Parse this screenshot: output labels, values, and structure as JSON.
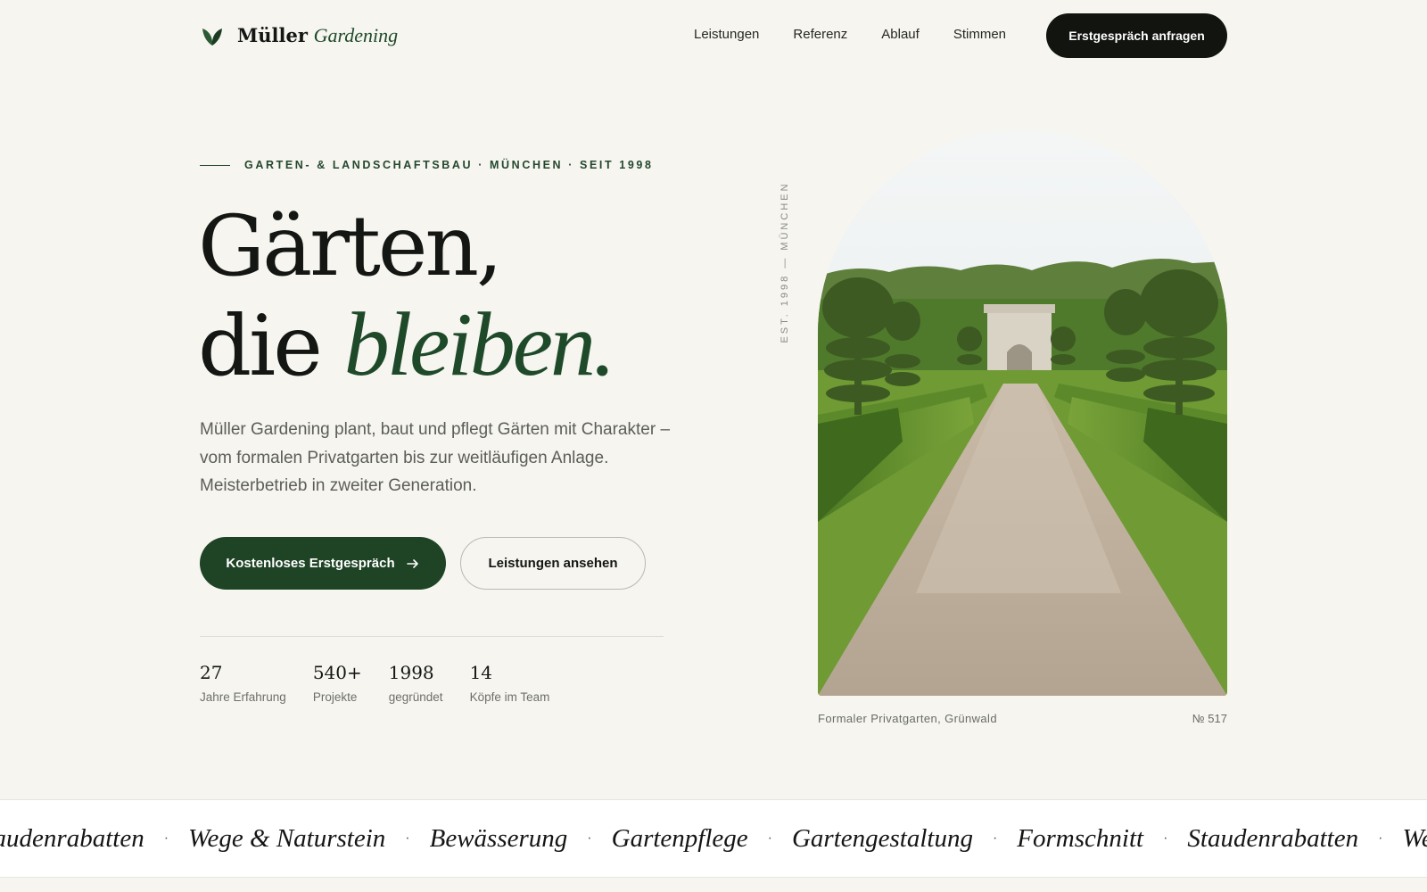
{
  "brand": {
    "name_bold": "Müller",
    "name_italic": "Gardening"
  },
  "nav": {
    "links": [
      "Leistungen",
      "Referenz",
      "Ablauf",
      "Stimmen"
    ],
    "cta": "Erstgespräch anfragen"
  },
  "hero": {
    "eyebrow": "GARTEN- & LANDSCHAFTSBAU · MÜNCHEN · SEIT 1998",
    "headline_line1": "Gärten,",
    "headline_line2_plain": "die",
    "headline_line2_italic": "bleiben.",
    "lead": "Müller Gardening plant, baut und pflegt Gärten mit Charakter – vom formalen Privatgarten bis zur weitläufigen Anlage. Meisterbetrieb in zweiter Generation.",
    "primary_cta": "Kostenloses Erstgespräch",
    "secondary_cta": "Leistungen ansehen",
    "stats": [
      {
        "value": "27",
        "label": "Jahre Erfahrung"
      },
      {
        "value": "540+",
        "label": "Projekte"
      },
      {
        "value": "1998",
        "label": "gegründet"
      },
      {
        "value": "14",
        "label": "Köpfe im Team"
      }
    ],
    "vertical_label": "EST. 1998 — MÜNCHEN",
    "image_caption": "Formaler Privatgarten, Grünwald",
    "image_number": "№ 517"
  },
  "marquee": {
    "items": [
      "Staudenrabatten",
      "Wege & Naturstein",
      "Bewässerung",
      "Gartenpflege",
      "Gartengestaltung",
      "Formschnitt",
      "Staudenrabatten",
      "Wege & Naturstein"
    ]
  },
  "colors": {
    "background": "#f6f5f0",
    "accent_green": "#1e4325",
    "dark": "#121410"
  },
  "icons": [
    "leaf-logo-icon",
    "arrow-right-icon"
  ]
}
